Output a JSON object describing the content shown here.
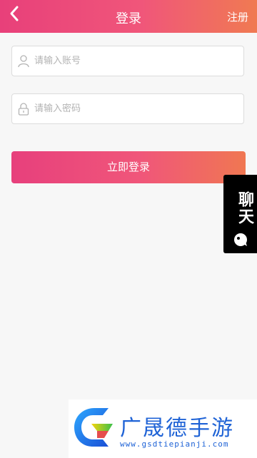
{
  "header": {
    "back_icon": "chevron-left-icon",
    "title": "登录",
    "register_label": "注册"
  },
  "form": {
    "account": {
      "placeholder": "请输入账号",
      "value": "",
      "icon": "user-icon"
    },
    "password": {
      "placeholder": "请输入密码",
      "value": "",
      "icon": "lock-icon"
    },
    "submit_label": "立即登录"
  },
  "side_tab": {
    "label": "聊天",
    "icon": "chat-bubble-icon"
  },
  "watermark": {
    "name": "广晟德手游",
    "url": "www.gsdtiepianji.com"
  },
  "colors": {
    "gradient_start": "#e8407a",
    "gradient_end": "#f07a52",
    "background": "#f7f7f7",
    "watermark_blue": "#1f63d6"
  }
}
